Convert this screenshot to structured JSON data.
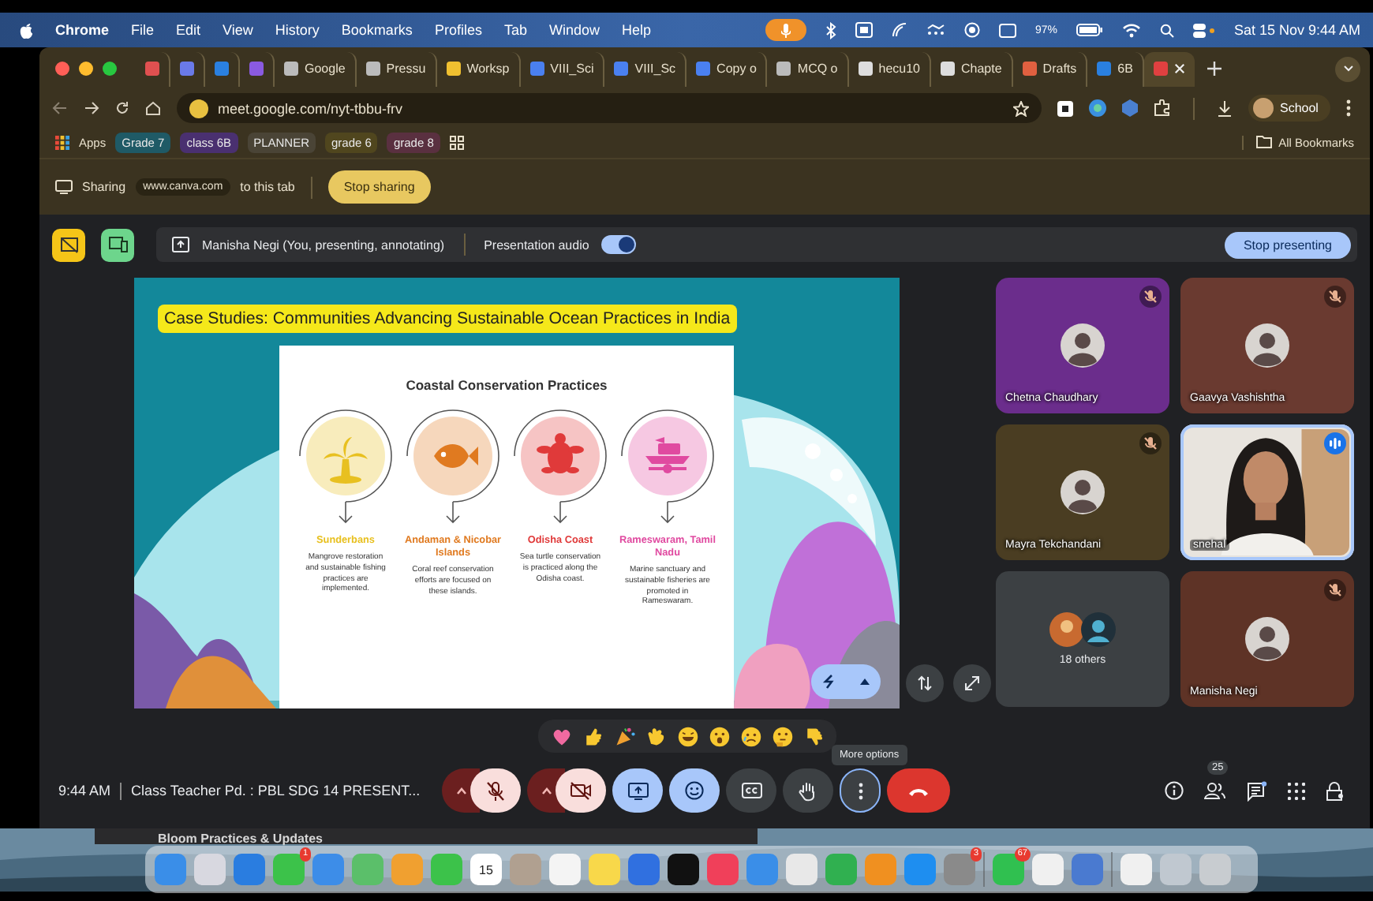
{
  "menu_bar": {
    "app": "Chrome",
    "menus": [
      "File",
      "Edit",
      "View",
      "History",
      "Bookmarks",
      "Profiles",
      "Tab",
      "Window",
      "Help"
    ],
    "battery": "97%",
    "clock": "Sat 15 Nov 9:44 AM"
  },
  "tabs": [
    {
      "color": "#e05050",
      "selected": false
    },
    {
      "color": "#6a7ae8",
      "selected": false
    },
    {
      "color": "#2a80e0",
      "selected": false
    },
    {
      "color": "#8a5ae0",
      "selected": false
    },
    {
      "label": "Google",
      "color": "#bbbbbb",
      "selected": false
    },
    {
      "label": "Pressu",
      "color": "#bbbbbb",
      "selected": false
    },
    {
      "label": "Worksp",
      "color": "#f0c030",
      "selected": false
    },
    {
      "label": "VIII_Sci",
      "color": "#4a80f0",
      "selected": false
    },
    {
      "label": "VIII_Sc",
      "color": "#4a80f0",
      "selected": false
    },
    {
      "label": "Copy o",
      "color": "#4a80f0",
      "selected": false
    },
    {
      "label": "MCQ o",
      "color": "#bbbbbb",
      "selected": false
    },
    {
      "label": "hecu10",
      "color": "#dddddd",
      "selected": false
    },
    {
      "label": "Chapte",
      "color": "#dddddd",
      "selected": false
    },
    {
      "label": "Drafts",
      "color": "#e06040",
      "selected": false
    },
    {
      "label": "6B",
      "color": "#2a80e0",
      "selected": false
    },
    {
      "color": "#e04040",
      "selected": true
    }
  ],
  "address_bar": {
    "url": "meet.google.com/nyt-tbbu-frv",
    "profile": "School"
  },
  "bookmarks": {
    "apps": "Apps",
    "items": [
      {
        "label": "Grade 7",
        "color": "#1f5a66"
      },
      {
        "label": "class 6B",
        "color": "#4a3070"
      },
      {
        "label": "PLANNER",
        "color": "#4a4436"
      },
      {
        "label": "grade 6",
        "color": "#50461e"
      },
      {
        "label": "grade 8",
        "color": "#5a3040"
      }
    ],
    "all": "All Bookmarks"
  },
  "sharing_bar": {
    "label": "Sharing",
    "site": "www.canva.com",
    "suffix": "to this tab",
    "button": "Stop sharing"
  },
  "presenting_bar": {
    "presenter": "Manisha Negi (You, presenting, annotating)",
    "audio_label": "Presentation audio",
    "audio_on": true,
    "button": "Stop presenting"
  },
  "slide": {
    "title": "Case Studies: Communities Advancing Sustainable Ocean Practices in India",
    "card_title": "Coastal Conservation Practices",
    "columns": [
      {
        "kind": "palm",
        "name": "Sunderbans",
        "text": "Mangrove restoration and sustainable fishing practices are implemented.",
        "color": "#e8c020"
      },
      {
        "kind": "fish",
        "name": "Andaman & Nicobar Islands",
        "text": "Coral reef conservation efforts are focused on these islands.",
        "color": "#e07a20"
      },
      {
        "kind": "turtle",
        "name": "Odisha Coast",
        "text": "Sea turtle conservation is practiced along the Odisha coast.",
        "color": "#e03a3a"
      },
      {
        "kind": "boat",
        "name": "Rameswaram, Tamil Nadu",
        "text": "Marine sanctuary and sustainable fisheries are promoted in Rameswaram.",
        "color": "#e04aa0"
      }
    ]
  },
  "participants": [
    {
      "kind": "avatar",
      "name": "Chetna Chaudhary",
      "muted": true,
      "speaking": false,
      "color": "#6b2d8c"
    },
    {
      "kind": "avatar",
      "name": "Gaavya Vashishtha",
      "muted": true,
      "speaking": false,
      "color": "#6a3a30"
    },
    {
      "kind": "avatar",
      "name": "Mayra Tekchandani",
      "muted": true,
      "speaking": false,
      "color": "#4a3d22"
    },
    {
      "kind": "video",
      "name": "snehal",
      "muted": false,
      "speaking": true,
      "color": "#e8e4de"
    },
    {
      "kind": "others",
      "name": "18 others",
      "muted": false,
      "speaking": false,
      "color": "#3c4043"
    },
    {
      "kind": "avatar",
      "name": "Manisha Negi",
      "muted": true,
      "speaking": false,
      "color": "#5e3326"
    }
  ],
  "reactions": [
    {
      "kind": "heart"
    },
    {
      "kind": "thumbs-up"
    },
    {
      "kind": "party"
    },
    {
      "kind": "clap"
    },
    {
      "kind": "laugh"
    },
    {
      "kind": "surprised"
    },
    {
      "kind": "sad"
    },
    {
      "kind": "thinking"
    },
    {
      "kind": "thumbs-down"
    }
  ],
  "call_bar": {
    "time": "9:44 AM",
    "meeting": "Class Teacher Pd. : PBL SDG 14 PRESENT...",
    "mic_on": false,
    "camera_on": false,
    "tooltip": "More options",
    "people_count": "25"
  },
  "desktop": {
    "window_text": "Bloom Practices & Updates"
  },
  "dock": [
    {
      "color": "#3a8ee8"
    },
    {
      "color": "#d8d8e0"
    },
    {
      "color": "#2a7de0"
    },
    {
      "color": "#3cc24a",
      "badge": "1"
    },
    {
      "color": "#3d8de8"
    },
    {
      "color": "#5bbf6a"
    },
    {
      "color": "#f0a030"
    },
    {
      "color": "#3cc24a"
    },
    {
      "color": "#ffffff",
      "label": "15"
    },
    {
      "color": "#b0a090"
    },
    {
      "color": "#f4f4f4"
    },
    {
      "color": "#f8d84a"
    },
    {
      "color": "#3070e0"
    },
    {
      "color": "#111111"
    },
    {
      "color": "#f0405a"
    },
    {
      "color": "#3a8ee8"
    },
    {
      "color": "#e8e8e8"
    },
    {
      "color": "#30b050"
    },
    {
      "color": "#f09020"
    },
    {
      "color": "#1e8ef0"
    },
    {
      "color": "#8a8a8a",
      "badge": "3"
    },
    {
      "color": "#30c050",
      "badge": "67"
    },
    {
      "color": "#f0f0f0"
    },
    {
      "color": "#4a7ad0"
    },
    {
      "color": "#f0f0f0"
    },
    {
      "color": "#c0c8d0"
    },
    {
      "color": "#c8ccd0"
    }
  ]
}
